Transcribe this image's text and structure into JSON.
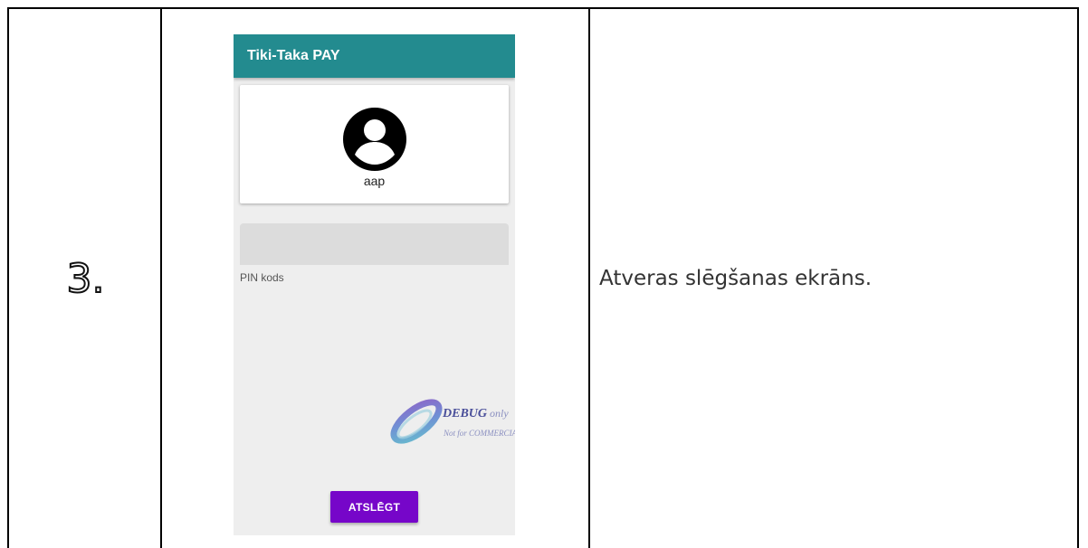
{
  "table": {
    "step_number": "3.",
    "description": "Atveras slēgšanas ekrāns."
  },
  "app": {
    "title": "Tiki-Taka PAY",
    "user": {
      "avatar_icon": "account-circle-icon",
      "username": "aap"
    },
    "pin_field": {
      "value": "",
      "label": "PIN kods"
    },
    "watermark": {
      "main": "DEBUG",
      "only": "only",
      "sub": "Not for COMMERCIAL"
    },
    "unlock_button": "ATSLĒGT",
    "colors": {
      "appbar": "#238b8f",
      "button": "#7606c9",
      "background": "#eeeeee"
    }
  }
}
